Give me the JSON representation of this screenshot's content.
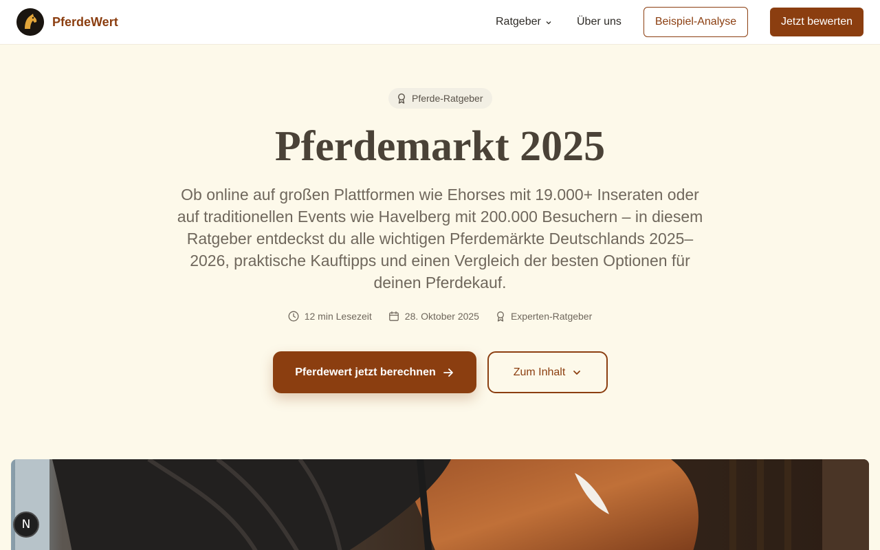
{
  "header": {
    "brand": "PferdeWert",
    "nav": {
      "ratgeber": "Ratgeber",
      "ueber_uns": "Über uns"
    },
    "buttons": {
      "example": "Beispiel-Analyse",
      "evaluate": "Jetzt bewerten"
    }
  },
  "hero": {
    "badge": "Pferde-Ratgeber",
    "title": "Pferdemarkt 2025",
    "lead": "Ob online auf großen Plattformen wie Ehorses mit 19.000+ Inseraten oder auf traditionellen Events wie Havelberg mit 200.000 Besuchern – in diesem Ratgeber entdeckst du alle wichtigen Pferdemärkte Deutschlands 2025–2026, praktische Kauftipps und einen Vergleich der besten Optionen für deinen Pferdekauf.",
    "meta": {
      "read_time": "12 min Lesezeit",
      "date": "28. Oktober 2025",
      "type": "Experten-Ratgeber"
    },
    "cta_primary": "Pferdewert jetzt berechnen",
    "cta_secondary": "Zum Inhalt"
  },
  "floating_badge": "N",
  "colors": {
    "accent": "#8b3e10",
    "background": "#fdf9ea",
    "text": "#4a4237"
  }
}
